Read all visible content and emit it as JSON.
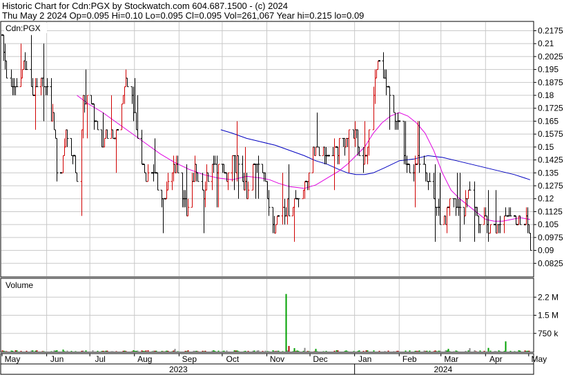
{
  "header": {
    "line1": "Historic Chart for Cdn:PGX by Stockwatch.com 604.687.1500 - (c) 2024",
    "line2": "Thu May  2 2024  Op=0.095  Hi=0.10  Lo=0.095  Cl=0.095  Vol=261,067  Year hi=0.215  lo=0.09"
  },
  "price_panel": {
    "label": "Cdn:PGX"
  },
  "volume_panel": {
    "label": "Volume"
  },
  "colors": {
    "up": "#d00000",
    "down": "#000000",
    "ma_short": "#e000e0",
    "ma_long": "#0000c0",
    "vol_up": "#00a000",
    "vol_down": "#b00000",
    "vol_flat": "#888888",
    "grid": "#c8c8c8"
  },
  "chart_data": [
    {
      "type": "ohlc",
      "title": "Historic Chart for Cdn:PGX",
      "ylim": [
        0.075,
        0.2225
      ],
      "y_ticks": [
        "0.0825",
        "0.09",
        "0.0975",
        "0.105",
        "0.1125",
        "0.12",
        "0.1275",
        "0.135",
        "0.1425",
        "0.15",
        "0.1575",
        "0.165",
        "0.1725",
        "0.18",
        "0.1875",
        "0.195",
        "0.2025",
        "0.21",
        "0.2175"
      ],
      "x_months": [
        {
          "label": "May",
          "day": 0
        },
        {
          "label": "Jun",
          "day": 31
        },
        {
          "label": "Jul",
          "day": 61
        },
        {
          "label": "Aug",
          "day": 92
        },
        {
          "label": "Sep",
          "day": 123
        },
        {
          "label": "Oct",
          "day": 153
        },
        {
          "label": "Nov",
          "day": 184
        },
        {
          "label": "Dec",
          "day": 214
        },
        {
          "label": "Jan",
          "day": 245
        },
        {
          "label": "Feb",
          "day": 276
        },
        {
          "label": "Mar",
          "day": 305
        },
        {
          "label": "Apr",
          "day": 336
        },
        {
          "label": "May",
          "day": 366
        }
      ],
      "x_years": [
        {
          "label": "2023",
          "start_day": 0,
          "end_day": 245
        },
        {
          "label": "2024",
          "start_day": 245,
          "end_day": 368
        }
      ],
      "price_waypoints": [
        [
          0,
          0.215
        ],
        [
          3,
          0.19
        ],
        [
          6,
          0.18
        ],
        [
          9,
          0.185
        ],
        [
          12,
          0.19
        ],
        [
          15,
          0.2
        ],
        [
          18,
          0.19
        ],
        [
          22,
          0.18
        ],
        [
          26,
          0.19
        ],
        [
          30,
          0.185
        ],
        [
          33,
          0.17
        ],
        [
          36,
          0.165
        ],
        [
          38,
          0.14
        ],
        [
          41,
          0.135
        ],
        [
          44,
          0.16
        ],
        [
          47,
          0.15
        ],
        [
          50,
          0.14
        ],
        [
          53,
          0.125
        ],
        [
          56,
          0.175
        ],
        [
          60,
          0.18
        ],
        [
          64,
          0.17
        ],
        [
          68,
          0.145
        ],
        [
          72,
          0.16
        ],
        [
          76,
          0.155
        ],
        [
          80,
          0.16
        ],
        [
          84,
          0.18
        ],
        [
          88,
          0.19
        ],
        [
          93,
          0.16
        ],
        [
          97,
          0.14
        ],
        [
          101,
          0.135
        ],
        [
          105,
          0.135
        ],
        [
          109,
          0.125
        ],
        [
          113,
          0.12
        ],
        [
          117,
          0.135
        ],
        [
          121,
          0.14
        ],
        [
          125,
          0.125
        ],
        [
          128,
          0.11
        ],
        [
          131,
          0.12
        ],
        [
          134,
          0.135
        ],
        [
          137,
          0.13
        ],
        [
          140,
          0.125
        ],
        [
          144,
          0.135
        ],
        [
          148,
          0.14
        ],
        [
          152,
          0.14
        ],
        [
          156,
          0.13
        ],
        [
          160,
          0.14
        ],
        [
          163,
          0.14
        ],
        [
          166,
          0.135
        ],
        [
          170,
          0.12
        ],
        [
          174,
          0.14
        ],
        [
          178,
          0.14
        ],
        [
          182,
          0.135
        ],
        [
          186,
          0.11
        ],
        [
          190,
          0.105
        ],
        [
          194,
          0.115
        ],
        [
          198,
          0.115
        ],
        [
          202,
          0.115
        ],
        [
          206,
          0.125
        ],
        [
          210,
          0.125
        ],
        [
          214,
          0.14
        ],
        [
          218,
          0.15
        ],
        [
          222,
          0.15
        ],
        [
          226,
          0.145
        ],
        [
          230,
          0.145
        ],
        [
          234,
          0.15
        ],
        [
          238,
          0.155
        ],
        [
          242,
          0.16
        ],
        [
          246,
          0.155
        ],
        [
          250,
          0.14
        ],
        [
          254,
          0.15
        ],
        [
          258,
          0.18
        ],
        [
          261,
          0.2
        ],
        [
          264,
          0.195
        ],
        [
          267,
          0.185
        ],
        [
          270,
          0.175
        ],
        [
          273,
          0.165
        ],
        [
          276,
          0.165
        ],
        [
          280,
          0.14
        ],
        [
          284,
          0.135
        ],
        [
          288,
          0.14
        ],
        [
          292,
          0.145
        ],
        [
          296,
          0.13
        ],
        [
          300,
          0.12
        ],
        [
          304,
          0.11
        ],
        [
          308,
          0.105
        ],
        [
          312,
          0.12
        ],
        [
          316,
          0.115
        ],
        [
          320,
          0.11
        ],
        [
          324,
          0.125
        ],
        [
          328,
          0.115
        ],
        [
          332,
          0.105
        ],
        [
          336,
          0.105
        ],
        [
          340,
          0.1
        ],
        [
          344,
          0.105
        ],
        [
          348,
          0.115
        ],
        [
          352,
          0.11
        ],
        [
          356,
          0.11
        ],
        [
          360,
          0.105
        ],
        [
          364,
          0.11
        ],
        [
          367,
          0.095
        ]
      ],
      "ma_short_waypoints": [
        [
          52,
          0.18
        ],
        [
          60,
          0.175
        ],
        [
          70,
          0.17
        ],
        [
          80,
          0.164
        ],
        [
          90,
          0.158
        ],
        [
          100,
          0.152
        ],
        [
          110,
          0.146
        ],
        [
          120,
          0.141
        ],
        [
          130,
          0.137
        ],
        [
          140,
          0.134
        ],
        [
          150,
          0.132
        ],
        [
          160,
          0.131
        ],
        [
          170,
          0.133
        ],
        [
          180,
          0.132
        ],
        [
          186,
          0.131
        ],
        [
          192,
          0.129
        ],
        [
          200,
          0.127
        ],
        [
          210,
          0.126
        ],
        [
          218,
          0.128
        ],
        [
          226,
          0.132
        ],
        [
          234,
          0.136
        ],
        [
          240,
          0.14
        ],
        [
          246,
          0.145
        ],
        [
          252,
          0.15
        ],
        [
          258,
          0.158
        ],
        [
          264,
          0.164
        ],
        [
          270,
          0.168
        ],
        [
          276,
          0.17
        ],
        [
          282,
          0.168
        ],
        [
          288,
          0.164
        ],
        [
          294,
          0.158
        ],
        [
          300,
          0.148
        ],
        [
          306,
          0.135
        ],
        [
          312,
          0.125
        ],
        [
          318,
          0.12
        ],
        [
          324,
          0.116
        ],
        [
          330,
          0.112
        ],
        [
          336,
          0.108
        ],
        [
          342,
          0.107
        ],
        [
          348,
          0.107
        ],
        [
          354,
          0.108
        ],
        [
          360,
          0.109
        ],
        [
          367,
          0.108
        ]
      ],
      "ma_long_waypoints": [
        [
          152,
          0.16
        ],
        [
          160,
          0.158
        ],
        [
          170,
          0.155
        ],
        [
          180,
          0.153
        ],
        [
          190,
          0.151
        ],
        [
          200,
          0.148
        ],
        [
          210,
          0.145
        ],
        [
          218,
          0.142
        ],
        [
          226,
          0.14
        ],
        [
          234,
          0.137
        ],
        [
          240,
          0.135
        ],
        [
          246,
          0.134
        ],
        [
          252,
          0.134
        ],
        [
          258,
          0.135
        ],
        [
          266,
          0.138
        ],
        [
          276,
          0.142
        ],
        [
          286,
          0.143
        ],
        [
          296,
          0.145
        ],
        [
          306,
          0.144
        ],
        [
          316,
          0.142
        ],
        [
          326,
          0.14
        ],
        [
          336,
          0.138
        ],
        [
          346,
          0.136
        ],
        [
          356,
          0.134
        ],
        [
          367,
          0.131
        ]
      ]
    },
    {
      "type": "bar",
      "title": "Volume",
      "ylim": [
        0,
        3000000
      ],
      "y_ticks": [
        "750 k",
        "1.5 M",
        "2.2 M"
      ],
      "y_tick_values": [
        750000,
        1500000,
        2250000
      ],
      "spikes": [
        [
          197,
          2380000,
          "up"
        ],
        [
          201,
          2250000,
          "up"
        ],
        [
          199,
          230000,
          "down"
        ],
        [
          203,
          140000,
          "up"
        ],
        [
          210,
          150000,
          "flat"
        ],
        [
          215,
          120000,
          "up"
        ],
        [
          218,
          110000,
          "up"
        ],
        [
          166,
          80000,
          "up"
        ],
        [
          180,
          75000,
          "flat"
        ],
        [
          305,
          400000,
          "flat"
        ],
        [
          325,
          140000,
          "flat"
        ],
        [
          338,
          150000,
          "up"
        ],
        [
          350,
          420000,
          "up"
        ],
        [
          355,
          180000,
          "flat"
        ],
        [
          120,
          110000,
          "flat"
        ],
        [
          42,
          80000,
          "up"
        ],
        [
          4,
          70000,
          "flat"
        ],
        [
          250,
          70000,
          "up"
        ],
        [
          310,
          110000,
          "up"
        ]
      ]
    }
  ]
}
